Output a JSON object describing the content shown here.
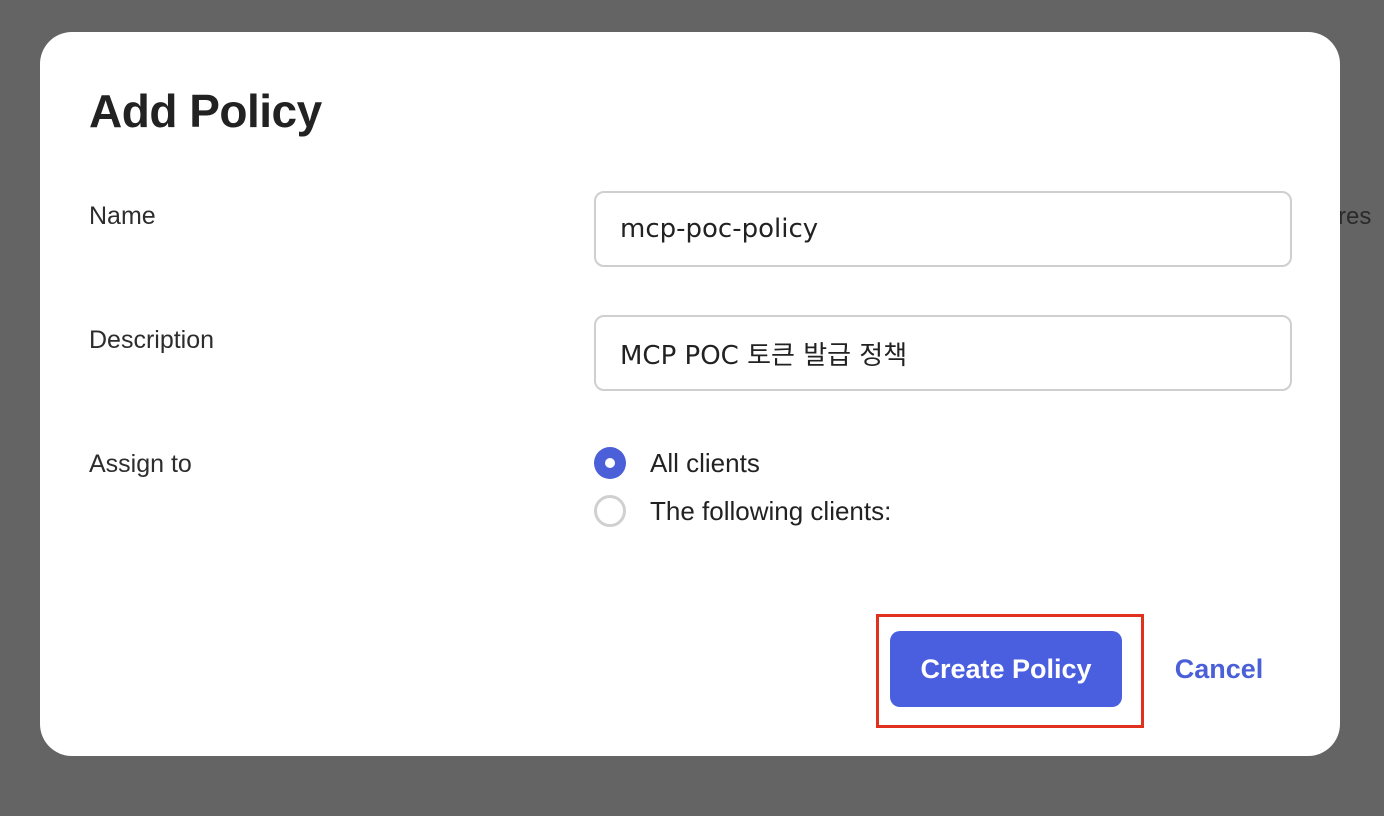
{
  "background": {
    "peek_text": "res"
  },
  "modal": {
    "title": "Add Policy",
    "fields": {
      "name": {
        "label": "Name",
        "value": "mcp-poc-policy"
      },
      "description": {
        "label": "Description",
        "value": "MCP POC 토큰 발급 정책"
      },
      "assign_to": {
        "label": "Assign to",
        "options": [
          {
            "label": "All clients",
            "selected": true
          },
          {
            "label": "The following clients:",
            "selected": false
          }
        ]
      }
    },
    "actions": {
      "create_label": "Create Policy",
      "cancel_label": "Cancel"
    }
  },
  "colors": {
    "accent": "#4a5fe0",
    "highlight": "#e0301e",
    "overlay": "#646464"
  }
}
